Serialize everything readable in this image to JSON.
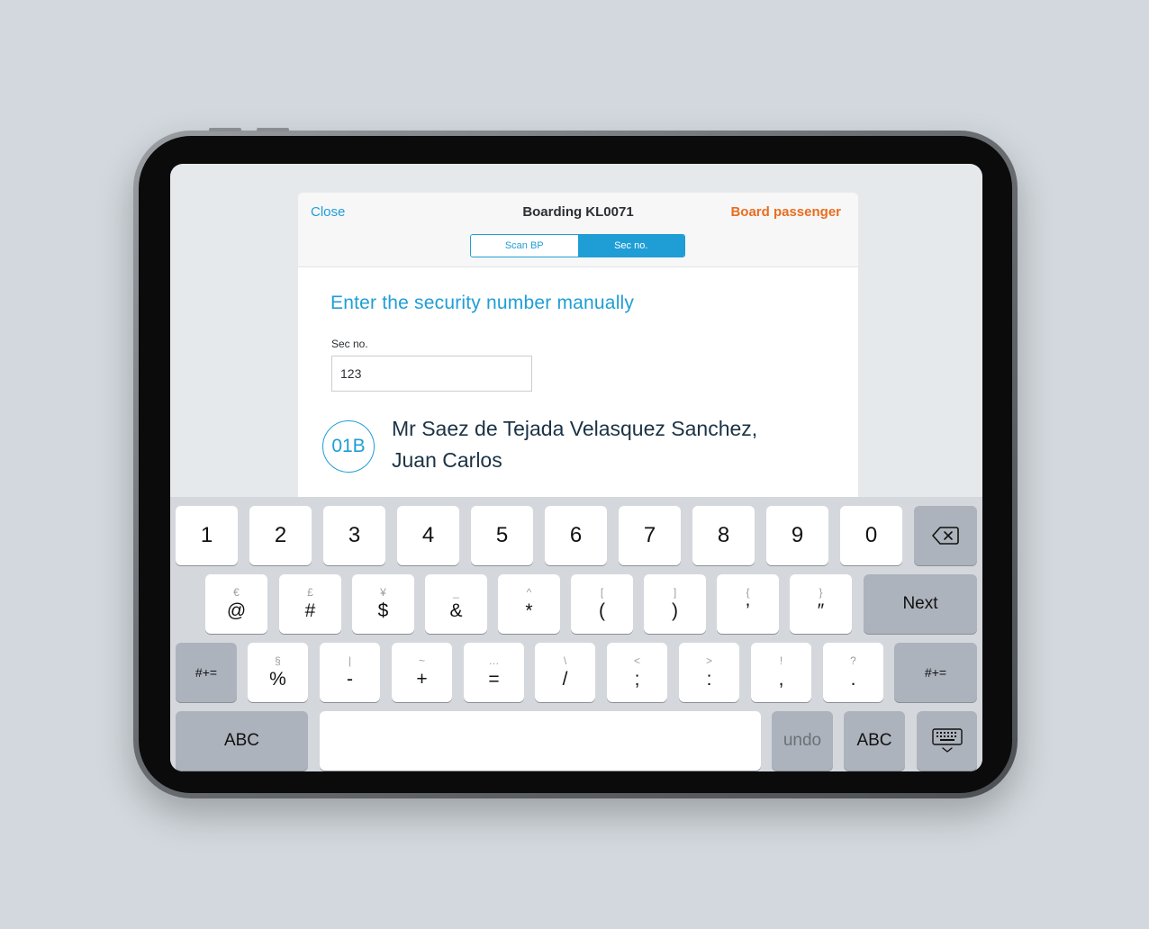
{
  "header": {
    "close_label": "Close",
    "title": "Boarding KL0071",
    "board_label": "Board passenger",
    "segments": [
      {
        "label": "Scan BP",
        "selected": false
      },
      {
        "label": "Sec no.",
        "selected": true
      }
    ]
  },
  "body": {
    "heading": "Enter the security number manually",
    "field_label": "Sec no.",
    "field_value": "123",
    "seat": "01B",
    "passenger_line1": "Mr Saez de Tejada Velasquez Sanchez,",
    "passenger_line2": "Juan Carlos"
  },
  "keyboard": {
    "row1": [
      "1",
      "2",
      "3",
      "4",
      "5",
      "6",
      "7",
      "8",
      "9",
      "0"
    ],
    "delete_icon": "backspace-icon",
    "row2": [
      {
        "top": "€",
        "main": "@"
      },
      {
        "top": "£",
        "main": "#"
      },
      {
        "top": "¥",
        "main": "$"
      },
      {
        "top": "_",
        "main": "&"
      },
      {
        "top": "^",
        "main": "*"
      },
      {
        "top": "[",
        "main": "("
      },
      {
        "top": "]",
        "main": ")"
      },
      {
        "top": "{",
        "main": "’"
      },
      {
        "top": "}",
        "main": "″"
      }
    ],
    "next_label": "Next",
    "row3": [
      {
        "top": "§",
        "main": "%"
      },
      {
        "top": "|",
        "main": "-"
      },
      {
        "top": "~",
        "main": "+"
      },
      {
        "top": "…",
        "main": "="
      },
      {
        "top": "\\",
        "main": "/"
      },
      {
        "top": "<",
        "main": ";"
      },
      {
        "top": ">",
        "main": ":"
      },
      {
        "top": "!",
        "main": ","
      },
      {
        "top": "?",
        "main": "."
      }
    ],
    "symbols_label": "#+=",
    "abc_label": "ABC",
    "undo_label": "undo",
    "dismiss_icon": "keyboard-dismiss-icon"
  },
  "colors": {
    "accent": "#1f9ed6",
    "action": "#e86d1f"
  }
}
